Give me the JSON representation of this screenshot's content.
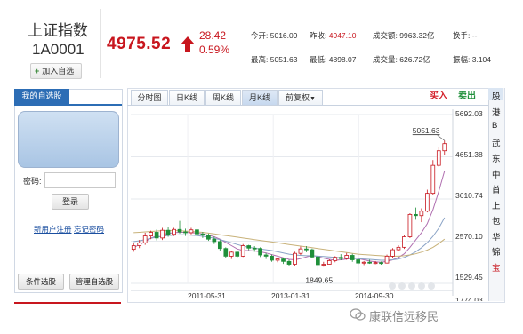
{
  "header": {
    "index_name": "上证指数",
    "index_code": "1A0001",
    "add_button": "加入自选",
    "price": "4975.52",
    "change": "28.42",
    "change_pct": "0.59%",
    "stats": [
      {
        "label": "今开:",
        "value": "5016.09",
        "color": "#333333"
      },
      {
        "label": "昨收:",
        "value": "4947.10",
        "color": "#c8161e"
      },
      {
        "label": "成交额:",
        "value": "9963.32亿",
        "color": "#333333"
      },
      {
        "label": "换手:",
        "value": "--",
        "color": "#333333"
      },
      {
        "label": "最高:",
        "value": "5051.63",
        "color": "#333333"
      },
      {
        "label": "最低:",
        "value": "4898.07",
        "color": "#333333"
      },
      {
        "label": "成交量:",
        "value": "626.72亿",
        "color": "#333333"
      },
      {
        "label": "振幅:",
        "value": "3.104",
        "color": "#333333"
      }
    ]
  },
  "left_panel": {
    "tab_label": "我的自选股",
    "password_label": "密码:",
    "password_value": "",
    "login_button": "登录",
    "register_link": "新用户注册",
    "forgot_link": "忘记密码",
    "condition_button": "条件选股",
    "manage_button": "管理自选股"
  },
  "chart_tabs": [
    "分时图",
    "日K线",
    "周K线",
    "月K线",
    "前复权"
  ],
  "active_tab": "月K线",
  "trade": {
    "buy": "买入",
    "sell": "卖出"
  },
  "side_tabs": [
    "股",
    "港",
    "B",
    "武",
    "东",
    "中",
    "首",
    "上",
    "包",
    "华",
    "锦",
    "宝"
  ],
  "colors": {
    "up": "#c8161e",
    "down": "#1f8f3a",
    "accent": "#2c6db5"
  },
  "chart_data": {
    "type": "candlestick",
    "y_ticks": [
      "5692.03",
      "4651.38",
      "3610.74",
      "2570.10",
      "1529.45",
      "1774.03"
    ],
    "x_ticks": [
      "2011-05-31",
      "2013-01-31",
      "2014-09-30"
    ],
    "annotations": {
      "high": "5051.63",
      "low": "1849.65"
    },
    "ylim": [
      1529.45,
      5692.03
    ],
    "candles": [
      {
        "o": 2370,
        "c": 2460,
        "h": 2520,
        "l": 2310
      },
      {
        "o": 2460,
        "c": 2530,
        "h": 2600,
        "l": 2400
      },
      {
        "o": 2530,
        "c": 2700,
        "h": 2780,
        "l": 2480
      },
      {
        "o": 2700,
        "c": 2790,
        "h": 2830,
        "l": 2620
      },
      {
        "o": 2790,
        "c": 2650,
        "h": 2860,
        "l": 2590
      },
      {
        "o": 2650,
        "c": 2840,
        "h": 2900,
        "l": 2600
      },
      {
        "o": 2840,
        "c": 2740,
        "h": 2920,
        "l": 2680
      },
      {
        "o": 2740,
        "c": 2860,
        "h": 2900,
        "l": 2700
      },
      {
        "o": 2860,
        "c": 2800,
        "h": 3070,
        "l": 2760
      },
      {
        "o": 2800,
        "c": 2780,
        "h": 2880,
        "l": 2700
      },
      {
        "o": 2780,
        "c": 2850,
        "h": 2900,
        "l": 2740
      },
      {
        "o": 2850,
        "c": 2750,
        "h": 2890,
        "l": 2700
      },
      {
        "o": 2750,
        "c": 2720,
        "h": 2800,
        "l": 2650
      },
      {
        "o": 2720,
        "c": 2620,
        "h": 2760,
        "l": 2580
      },
      {
        "o": 2620,
        "c": 2560,
        "h": 2680,
        "l": 2500
      },
      {
        "o": 2560,
        "c": 2390,
        "h": 2600,
        "l": 2330
      },
      {
        "o": 2390,
        "c": 2200,
        "h": 2420,
        "l": 2150
      },
      {
        "o": 2200,
        "c": 2300,
        "h": 2340,
        "l": 2130
      },
      {
        "o": 2300,
        "c": 2200,
        "h": 2330,
        "l": 2150
      },
      {
        "o": 2200,
        "c": 2460,
        "h": 2500,
        "l": 2180
      },
      {
        "o": 2460,
        "c": 2400,
        "h": 2480,
        "l": 2350
      },
      {
        "o": 2400,
        "c": 2390,
        "h": 2450,
        "l": 2310
      },
      {
        "o": 2390,
        "c": 2230,
        "h": 2420,
        "l": 2180
      },
      {
        "o": 2230,
        "c": 2200,
        "h": 2280,
        "l": 2130
      },
      {
        "o": 2200,
        "c": 2100,
        "h": 2240,
        "l": 2060
      },
      {
        "o": 2100,
        "c": 2130,
        "h": 2160,
        "l": 2050
      },
      {
        "o": 2130,
        "c": 2070,
        "h": 2160,
        "l": 2010
      },
      {
        "o": 2070,
        "c": 2000,
        "h": 2110,
        "l": 1960
      },
      {
        "o": 2000,
        "c": 2270,
        "h": 2310,
        "l": 1950
      },
      {
        "o": 2270,
        "c": 2380,
        "h": 2440,
        "l": 2230
      },
      {
        "o": 2380,
        "c": 2360,
        "h": 2450,
        "l": 2300
      },
      {
        "o": 2360,
        "c": 2180,
        "h": 2390,
        "l": 2150
      },
      {
        "o": 2180,
        "c": 1990,
        "h": 2200,
        "l": 1849.65
      },
      {
        "o": 1990,
        "c": 2000,
        "h": 2060,
        "l": 1940
      },
      {
        "o": 2000,
        "c": 2090,
        "h": 2120,
        "l": 1990
      },
      {
        "o": 2090,
        "c": 2170,
        "h": 2200,
        "l": 2050
      },
      {
        "o": 2170,
        "c": 2140,
        "h": 2250,
        "l": 2100
      },
      {
        "o": 2140,
        "c": 2220,
        "h": 2280,
        "l": 2110
      },
      {
        "o": 2220,
        "c": 2110,
        "h": 2260,
        "l": 2060
      },
      {
        "o": 2110,
        "c": 2030,
        "h": 2140,
        "l": 1990
      },
      {
        "o": 2030,
        "c": 2050,
        "h": 2080,
        "l": 1980
      },
      {
        "o": 2050,
        "c": 2030,
        "h": 2110,
        "l": 2010
      },
      {
        "o": 2030,
        "c": 2040,
        "h": 2080,
        "l": 2000
      },
      {
        "o": 2040,
        "c": 2030,
        "h": 2070,
        "l": 1990
      },
      {
        "o": 2030,
        "c": 2200,
        "h": 2240,
        "l": 2020
      },
      {
        "o": 2200,
        "c": 2360,
        "h": 2400,
        "l": 2160
      },
      {
        "o": 2360,
        "c": 2420,
        "h": 2470,
        "l": 2320
      },
      {
        "o": 2420,
        "c": 2680,
        "h": 2720,
        "l": 2380
      },
      {
        "o": 2680,
        "c": 3230,
        "h": 3260,
        "l": 2650
      },
      {
        "o": 3230,
        "c": 3200,
        "h": 3400,
        "l": 3100
      },
      {
        "o": 3200,
        "c": 3310,
        "h": 3380,
        "l": 3040
      },
      {
        "o": 3310,
        "c": 3750,
        "h": 3840,
        "l": 3280
      },
      {
        "o": 3750,
        "c": 4440,
        "h": 4570,
        "l": 3700
      },
      {
        "o": 4440,
        "c": 4800,
        "h": 4900,
        "l": 4400
      },
      {
        "o": 4800,
        "c": 4975.52,
        "h": 5051.63,
        "l": 4700
      }
    ],
    "ma_short": [
      2420,
      2480,
      2560,
      2650,
      2700,
      2740,
      2760,
      2780,
      2790,
      2790,
      2780,
      2770,
      2750,
      2720,
      2680,
      2620,
      2540,
      2460,
      2380,
      2340,
      2340,
      2330,
      2310,
      2280,
      2240,
      2200,
      2160,
      2120,
      2110,
      2140,
      2180,
      2220,
      2190,
      2150,
      2120,
      2100,
      2110,
      2130,
      2150,
      2140,
      2110,
      2080,
      2060,
      2050,
      2070,
      2110,
      2170,
      2260,
      2420,
      2600,
      2780,
      3000,
      3350,
      3800,
      4300
    ],
    "ma_mid": [
      2560,
      2580,
      2610,
      2640,
      2670,
      2690,
      2710,
      2720,
      2730,
      2730,
      2720,
      2710,
      2690,
      2670,
      2640,
      2610,
      2570,
      2530,
      2490,
      2450,
      2420,
      2400,
      2380,
      2360,
      2340,
      2310,
      2280,
      2250,
      2230,
      2220,
      2210,
      2210,
      2200,
      2190,
      2180,
      2170,
      2160,
      2150,
      2140,
      2140,
      2130,
      2120,
      2110,
      2100,
      2100,
      2110,
      2130,
      2170,
      2230,
      2310,
      2410,
      2530,
      2690,
      2890,
      3150
    ],
    "ma_long": [
      2780,
      2790,
      2800,
      2810,
      2820,
      2830,
      2830,
      2830,
      2830,
      2820,
      2810,
      2800,
      2790,
      2770,
      2750,
      2730,
      2710,
      2690,
      2670,
      2650,
      2630,
      2610,
      2590,
      2570,
      2550,
      2530,
      2510,
      2490,
      2470,
      2450,
      2430,
      2410,
      2390,
      2370,
      2350,
      2330,
      2310,
      2290,
      2270,
      2250,
      2240,
      2230,
      2220,
      2210,
      2200,
      2200,
      2200,
      2210,
      2230,
      2260,
      2300,
      2350,
      2420,
      2510,
      2620
    ]
  }
}
